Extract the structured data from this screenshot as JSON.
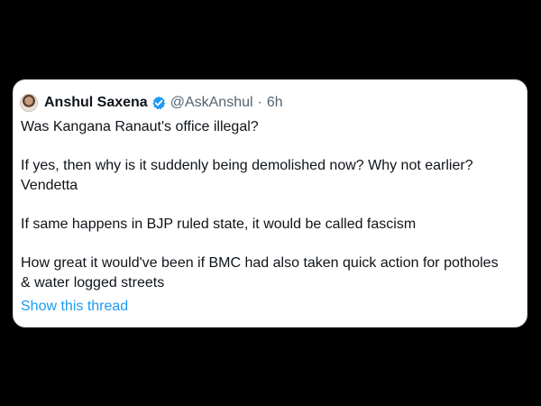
{
  "tweet": {
    "author": {
      "name": "Anshul Saxena",
      "handle": "@AskAnshul",
      "separator": "·",
      "time": "6h",
      "avatar_icon": "profile-photo",
      "verified_icon": "verified-badge-icon"
    },
    "paragraphs": [
      "Was Kangana Ranaut's office illegal?",
      "If yes, then why is it suddenly being demolished now? Why not earlier? Vendetta",
      "If same happens in BJP ruled state, it would be called fascism",
      "How great it would've been if BMC had also taken quick action for potholes & water logged streets"
    ],
    "show_thread_label": "Show this thread"
  },
  "colors": {
    "background": "#000000",
    "card": "#ffffff",
    "text": "#0f1419",
    "meta": "#536471",
    "link": "#1d9bf0",
    "verified": "#1d9bf0"
  }
}
